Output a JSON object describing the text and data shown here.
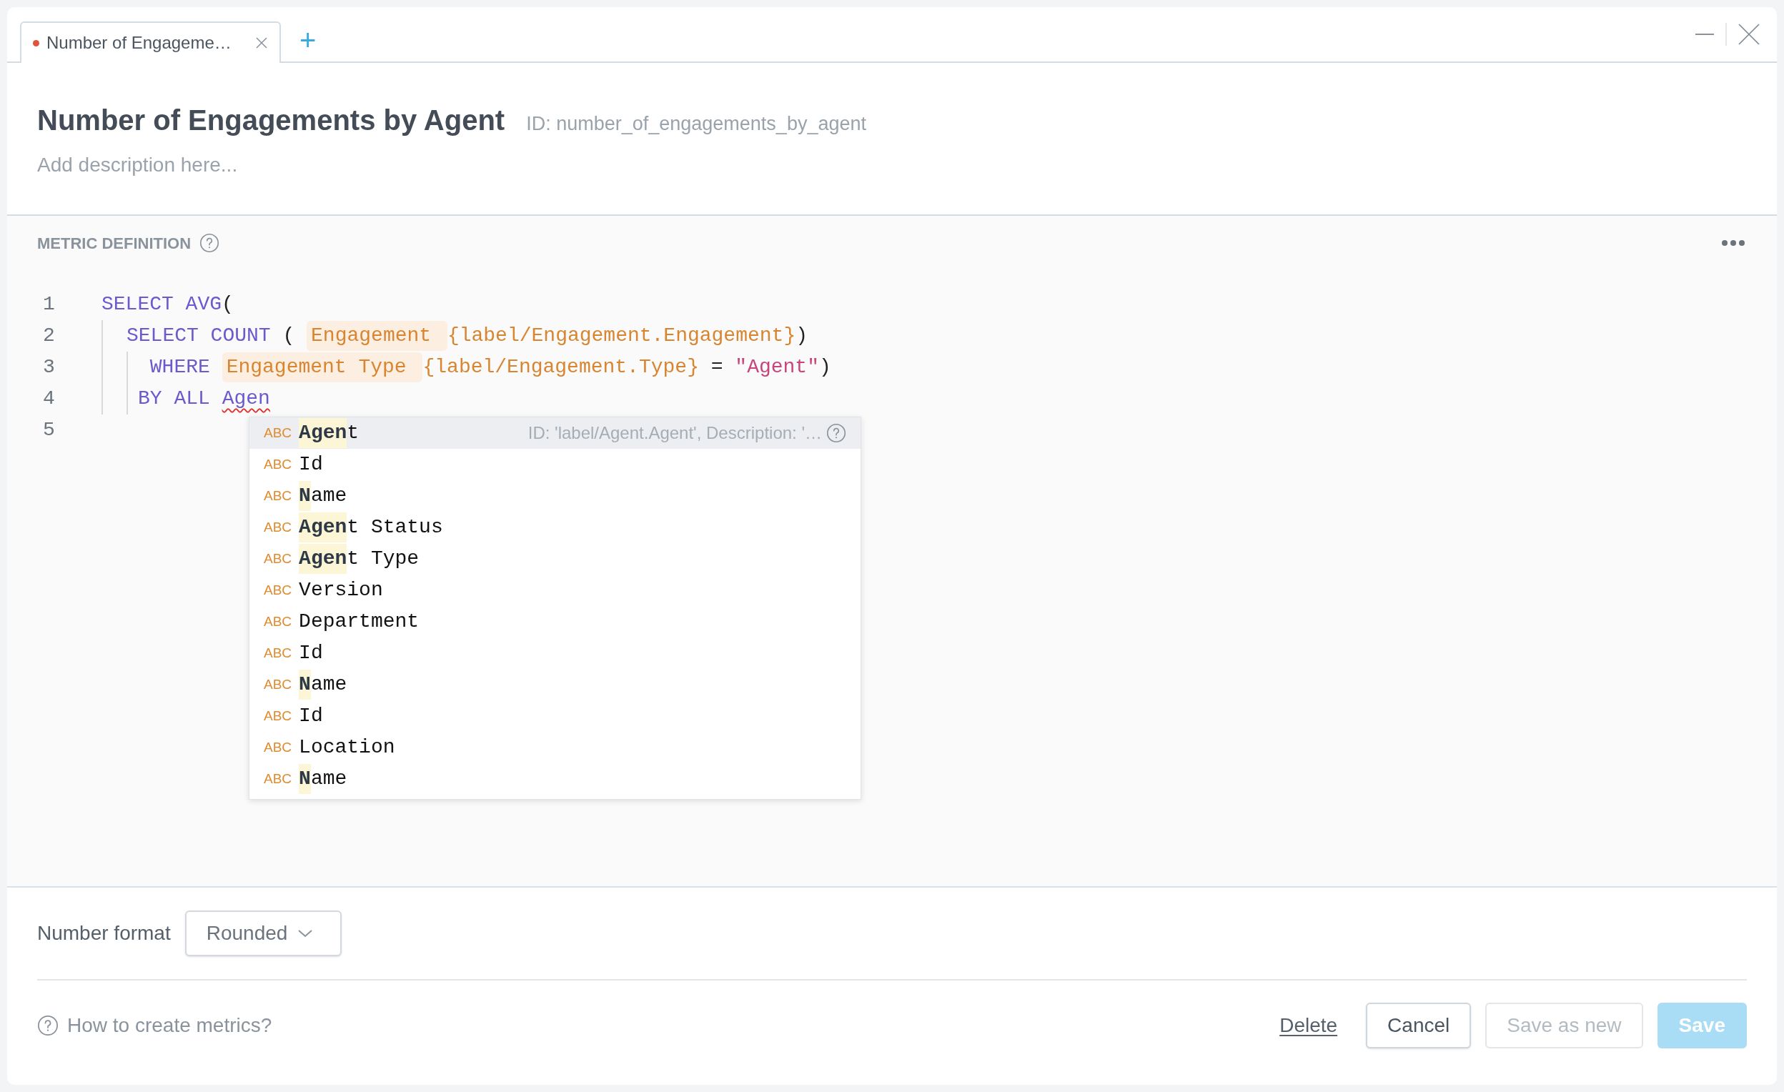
{
  "tabs": [
    {
      "label": "Number of Engageme…",
      "unsaved": true,
      "selected": true
    }
  ],
  "add_tab": "+",
  "metric": {
    "title": "Number of Engagements by Agent",
    "id": "ID: number_of_engagements_by_agent",
    "description_placeholder": "Add description here..."
  },
  "definition": {
    "heading": "METRIC DEFINITION",
    "lines": [
      {
        "number": "1",
        "tokens": [
          {
            "kind": "keyword",
            "text": "SELECT AVG"
          },
          {
            "kind": "punct",
            "text": "("
          }
        ],
        "children": [
          {
            "number": "2",
            "tokens": [
              {
                "kind": "keyword",
                "text": "SELECT COUNT"
              },
              {
                "kind": "punct",
                "text": " ( "
              },
              {
                "kind": "chip",
                "text": "Engagement "
              },
              {
                "kind": "ref",
                "text": "{label/Engagement.Engagement}"
              },
              {
                "kind": "punct",
                "text": ")"
              }
            ],
            "children": [
              {
                "number": "3",
                "tokens": [
                  {
                    "kind": "keyword",
                    "text": " WHERE "
                  },
                  {
                    "kind": "chip",
                    "text": "Engagement Type "
                  },
                  {
                    "kind": "ref",
                    "text": "{label/Engagement.Type}"
                  },
                  {
                    "kind": "punct",
                    "text": " = "
                  },
                  {
                    "kind": "string",
                    "text": "\"Agent\""
                  },
                  {
                    "kind": "punct",
                    "text": ")"
                  }
                ]
              },
              {
                "number": "4",
                "tokens": [
                  {
                    "kind": "keyword",
                    "text": "BY ALL "
                  },
                  {
                    "kind": "typing",
                    "text": "Agen"
                  }
                ]
              }
            ]
          }
        ]
      },
      {
        "number": "5"
      }
    ],
    "suggestions": [
      {
        "type": "ABC",
        "match": "Agen",
        "rest": "t",
        "selected": true,
        "detail": "ID: 'label/Agent.Agent', Description: '…"
      },
      {
        "type": "ABC",
        "rest": "Id",
        "selected": false
      },
      {
        "type": "ABC",
        "match": "N",
        "rest": "ame",
        "selected": false
      },
      {
        "type": "ABC",
        "match": "Agen",
        "rest": "t Status",
        "selected": false
      },
      {
        "type": "ABC",
        "match": "Agen",
        "rest": "t Type",
        "selected": false
      },
      {
        "type": "ABC",
        "rest": "Version",
        "selected": false
      },
      {
        "type": "ABC",
        "rest": "Department",
        "selected": false
      },
      {
        "type": "ABC",
        "rest": "Id",
        "selected": false
      },
      {
        "type": "ABC",
        "match": "N",
        "rest": "ame",
        "selected": false
      },
      {
        "type": "ABC",
        "rest": "Id",
        "selected": false
      },
      {
        "type": "ABC",
        "rest": "Location",
        "selected": false
      },
      {
        "type": "ABC",
        "match": "N",
        "rest": "ame",
        "selected": false
      }
    ]
  },
  "number_format": {
    "label": "Number format",
    "value": "Rounded"
  },
  "help_link": "How to create metrics?",
  "buttons": [
    {
      "kind": "link",
      "label": "Delete",
      "disabled": false
    },
    {
      "kind": "secondary",
      "label": "Cancel",
      "disabled": false
    },
    {
      "kind": "secondary",
      "label": "Save as new",
      "disabled": true
    },
    {
      "kind": "primary",
      "label": "Save",
      "disabled": true
    }
  ]
}
